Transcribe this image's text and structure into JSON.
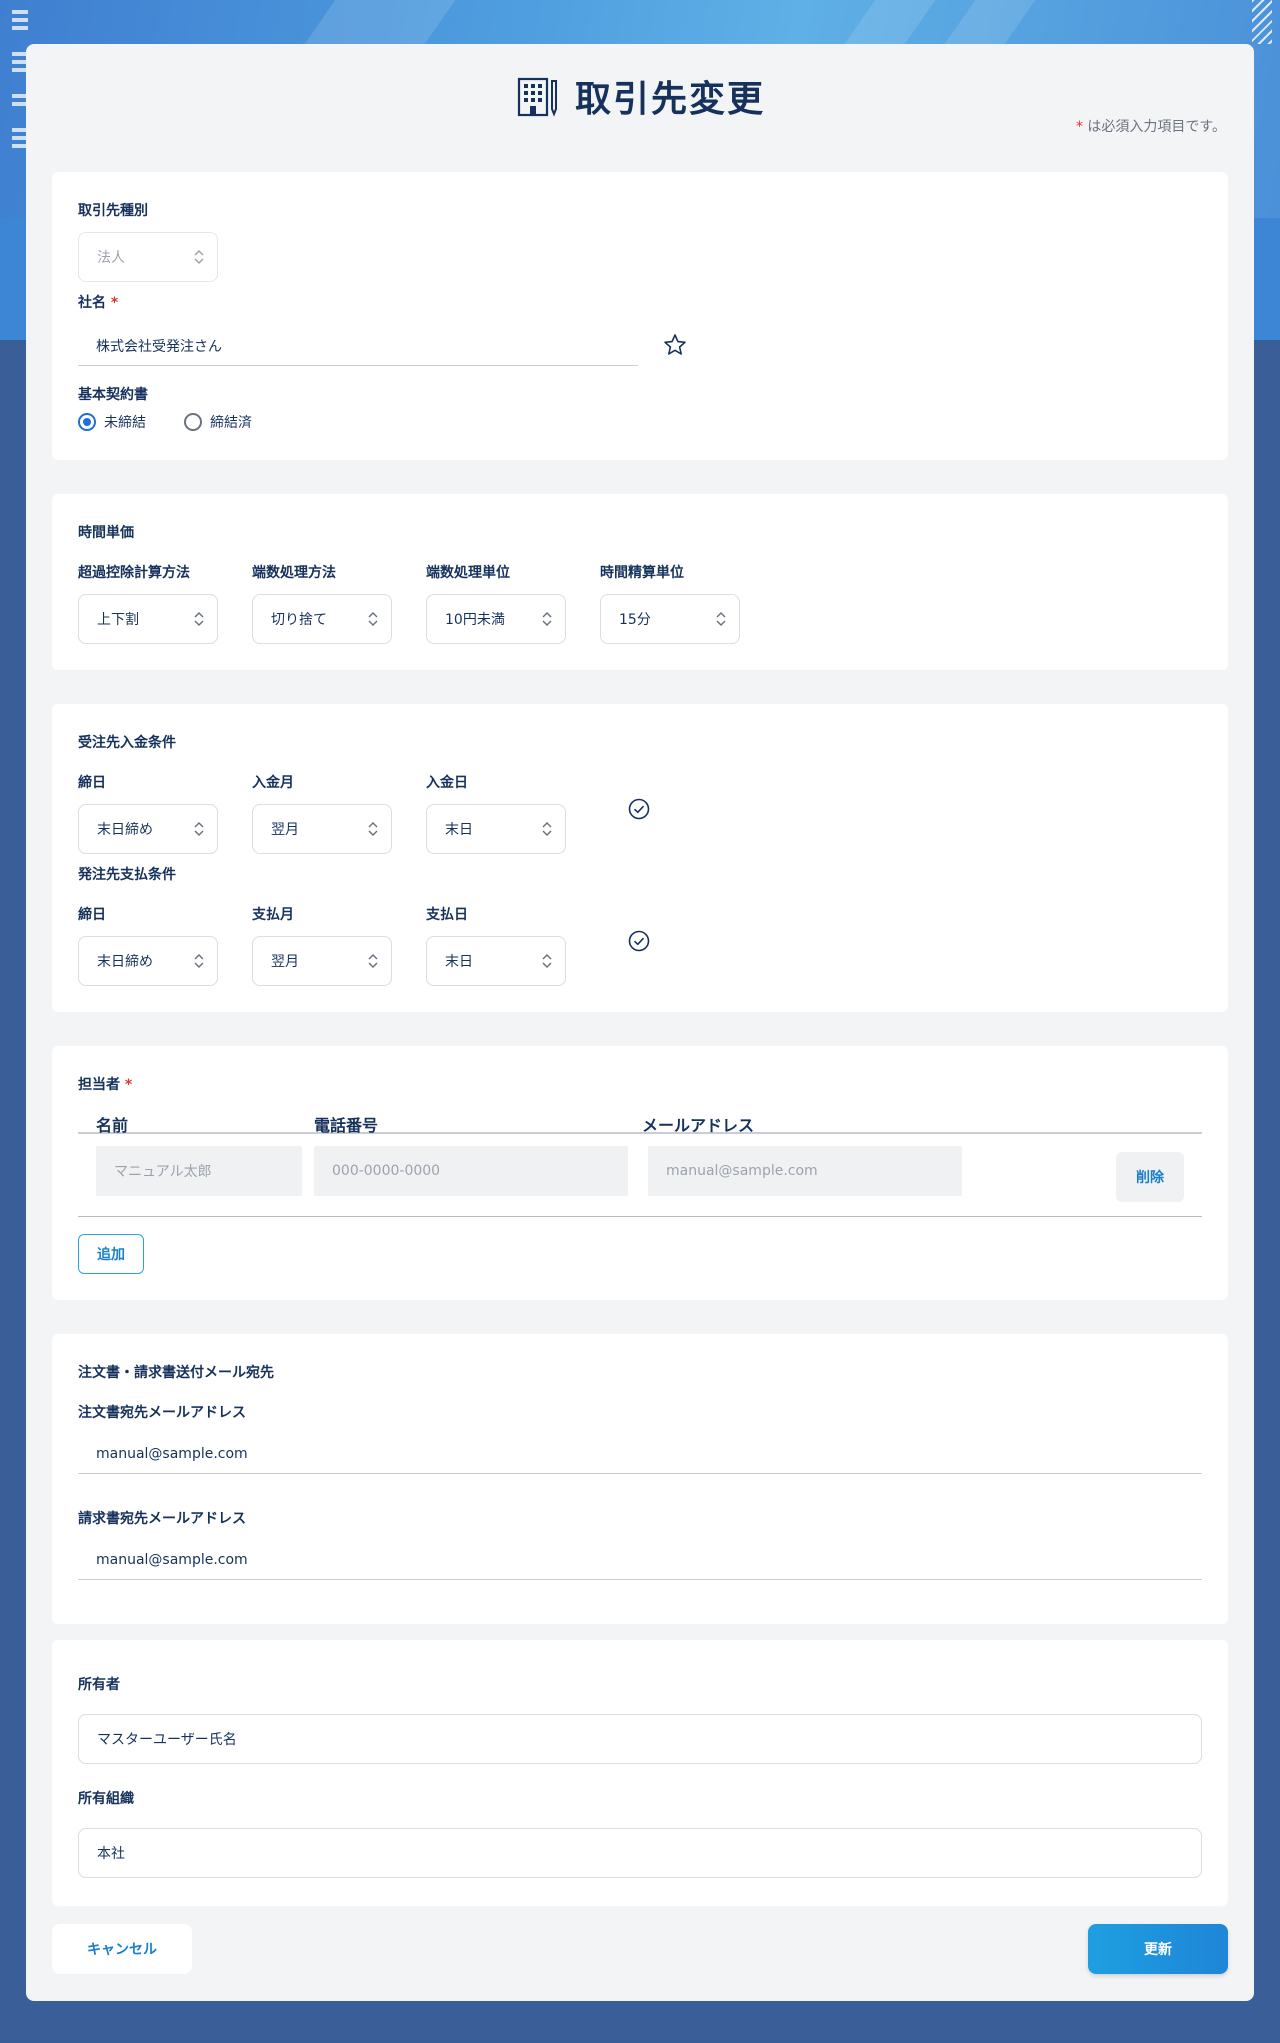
{
  "header": {
    "title": "取引先変更",
    "required_star": "*",
    "required_note": " は必須入力項目です。"
  },
  "basic": {
    "type_label": "取引先種別",
    "type_value": "法人",
    "company_label": "社名",
    "required_star": "*",
    "company_value": "株式会社受発注さん",
    "contract_label": "基本契約書",
    "contract_options": [
      "未締結",
      "締結済"
    ],
    "contract_selected": "未締結"
  },
  "hourly": {
    "section_label": "時間単価",
    "fields": [
      {
        "label": "超過控除計算方法",
        "value": "上下割"
      },
      {
        "label": "端数処理方法",
        "value": "切り捨て"
      },
      {
        "label": "端数処理単位",
        "value": "10円未満"
      },
      {
        "label": "時間精算単位",
        "value": "15分"
      }
    ]
  },
  "payment": {
    "receive_label": "受注先入金条件",
    "receive_fields": [
      {
        "label": "締日",
        "value": "末日締め"
      },
      {
        "label": "入金月",
        "value": "翌月"
      },
      {
        "label": "入金日",
        "value": "末日"
      }
    ],
    "pay_label": "発注先支払条件",
    "pay_fields": [
      {
        "label": "締日",
        "value": "末日締め"
      },
      {
        "label": "支払月",
        "value": "翌月"
      },
      {
        "label": "支払日",
        "value": "末日"
      }
    ]
  },
  "contacts": {
    "section_label": "担当者",
    "required_star": "*",
    "columns": [
      "名前",
      "電話番号",
      "メールアドレス"
    ],
    "rows": [
      {
        "name_placeholder": "マニュアル太郎",
        "phone_placeholder": "000-0000-0000",
        "email_placeholder": "manual@sample.com",
        "delete_label": "削除"
      }
    ],
    "add_label": "追加"
  },
  "mail": {
    "section_label": "注文書・請求書送付メール宛先",
    "order_label": "注文書宛先メールアドレス",
    "order_value": "manual@sample.com",
    "invoice_label": "請求書宛先メールアドレス",
    "invoice_value": "manual@sample.com"
  },
  "owner": {
    "owner_label": "所有者",
    "owner_value": "マスターユーザー氏名",
    "org_label": "所有組織",
    "org_value": "本社"
  },
  "footer": {
    "cancel_label": "キャンセル",
    "update_label": "更新"
  },
  "colors": {
    "primary_text": "#16325c",
    "accent": "#1f6fd6",
    "link": "#1a7fc9",
    "required": "#e03131"
  }
}
